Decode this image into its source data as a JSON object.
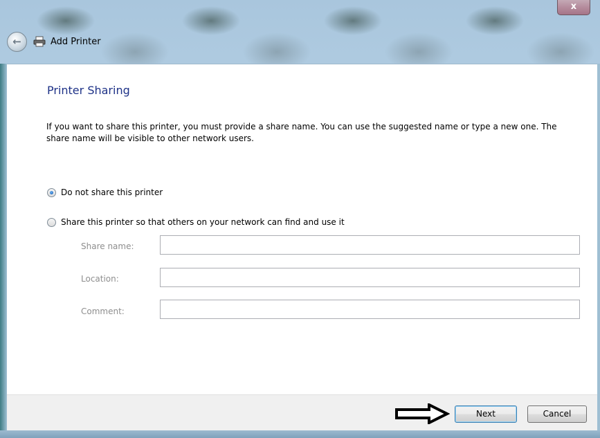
{
  "window": {
    "title": "Add Printer",
    "close_label": "x"
  },
  "page": {
    "heading": "Printer Sharing",
    "description": "If you want to share this printer, you must provide a share name. You can use the suggested name or type a new one. The share name will be visible to other network users."
  },
  "options": [
    {
      "label": "Do not share this printer",
      "selected": true
    },
    {
      "label": "Share this printer so that others on your network can find and use it",
      "selected": false
    }
  ],
  "fields": {
    "share_name": {
      "label": "Share name:",
      "value": ""
    },
    "location": {
      "label": "Location:",
      "value": ""
    },
    "comment": {
      "label": "Comment:",
      "value": ""
    }
  },
  "buttons": {
    "next": "Next",
    "cancel": "Cancel"
  },
  "icons": {
    "back": "back-arrow-icon",
    "printer": "printer-icon",
    "annotation": "pointing-arrow-icon"
  }
}
